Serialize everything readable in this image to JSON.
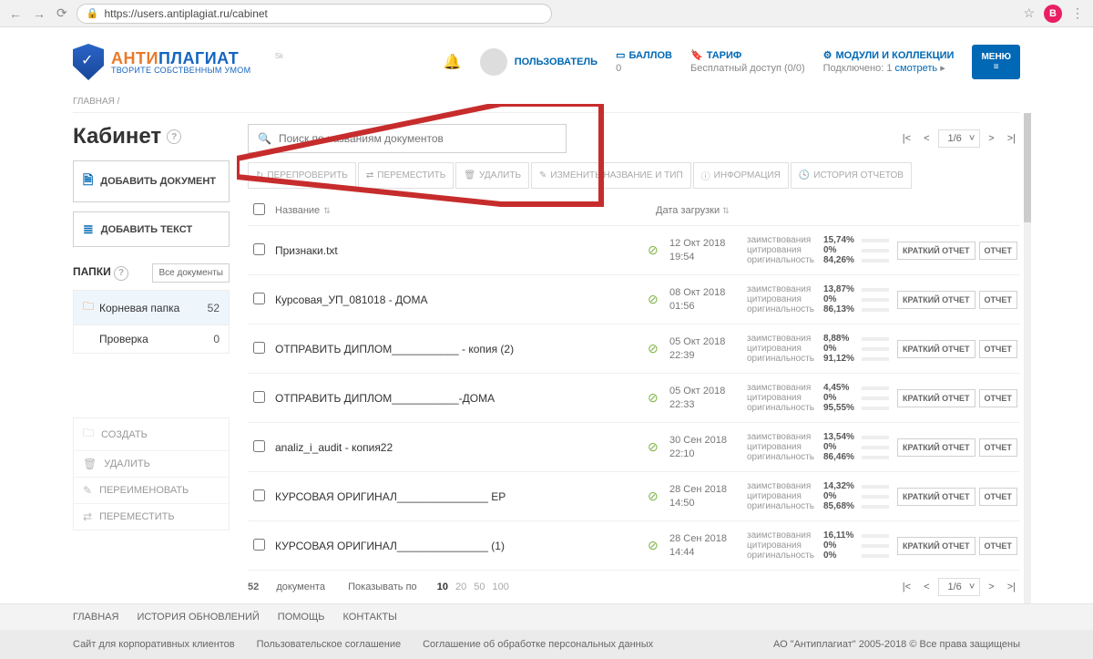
{
  "browser": {
    "url": "https://users.antiplagiat.ru/cabinet",
    "avatar_letter": "B"
  },
  "brand": {
    "part1": "АНТИ",
    "part2": "ПЛАГИАТ",
    "tagline": "ТВОРИТЕ СОБСТВЕННЫМ УМОМ",
    "sk": "Sk"
  },
  "header": {
    "user": "ПОЛЬЗОВАТЕЛЬ",
    "balance_title": "БАЛЛОВ",
    "balance_value": "0",
    "tariff_title": "ТАРИФ",
    "tariff_value": "Бесплатный доступ (0/0)",
    "modules_title": "МОДУЛИ И КОЛЛЕКЦИИ",
    "modules_value_a": "Подключено: 1",
    "modules_value_b": "смотреть",
    "menu": "МЕНЮ"
  },
  "breadcrumb": "ГЛАВНАЯ /",
  "sidebar": {
    "title": "Кабинет",
    "add_doc": "ДОБАВИТЬ ДОКУМЕНТ",
    "add_text": "ДОБАВИТЬ ТЕКСТ",
    "folders_title": "ПАПКИ",
    "all_docs": "Все документы",
    "root_folder": "Корневая папка",
    "root_count": "52",
    "subfolder": "Проверка",
    "sub_count": "0",
    "actions": {
      "create": "СОЗДАТЬ",
      "delete": "УДАЛИТЬ",
      "rename": "ПЕРЕИМЕНОВАТЬ",
      "move": "ПЕРЕМЕСТИТЬ"
    }
  },
  "search": {
    "placeholder": "Поиск по названиям документов"
  },
  "pager": {
    "text": "1/6"
  },
  "toolbar": {
    "recheck": "ПЕРЕПРОВЕРИТЬ",
    "move": "ПЕРЕМЕСТИТЬ",
    "delete": "УДАЛИТЬ",
    "rename": "ИЗМЕНИТЬ НАЗВАНИЕ И ТИП",
    "info": "ИНФОРМАЦИЯ",
    "history": "ИСТОРИЯ ОТЧЕТОВ"
  },
  "table": {
    "col_name": "Название",
    "col_date": "Дата загрузки",
    "total": "52",
    "total_label": "документа",
    "show_label": "Показывать по",
    "page_sizes": [
      "10",
      "20",
      "50",
      "100"
    ],
    "stat_labels": {
      "borrow": "заимствования",
      "cite": "цитирования",
      "orig": "оригинальность"
    },
    "btn_short": "КРАТКИЙ ОТЧЕТ",
    "btn_full": "ОТЧЕТ"
  },
  "docs": [
    {
      "name": "Признаки.txt",
      "date1": "12 Окт 2018",
      "date2": "19:54",
      "borrow": "15,74%",
      "cite": "0%",
      "orig": "84,26%",
      "bp": 16,
      "op": 84
    },
    {
      "name": "Курсовая_УП_081018 - ДОМА",
      "date1": "08 Окт 2018",
      "date2": "01:56",
      "borrow": "13,87%",
      "cite": "0%",
      "orig": "86,13%",
      "bp": 14,
      "op": 86
    },
    {
      "name": "ОТПРАВИТЬ ДИПЛОМ___________ - копия (2)",
      "date1": "05 Окт 2018",
      "date2": "22:39",
      "borrow": "8,88%",
      "cite": "0%",
      "orig": "91,12%",
      "bp": 9,
      "op": 91
    },
    {
      "name": "ОТПРАВИТЬ ДИПЛОМ___________-ДОМА",
      "date1": "05 Окт 2018",
      "date2": "22:33",
      "borrow": "4,45%",
      "cite": "0%",
      "orig": "95,55%",
      "bp": 4,
      "op": 96
    },
    {
      "name": "analiz_i_audit - копия22",
      "date1": "30 Сен 2018",
      "date2": "22:10",
      "borrow": "13,54%",
      "cite": "0%",
      "orig": "86,46%",
      "bp": 14,
      "op": 86
    },
    {
      "name": "КУРСОВАЯ ОРИГИНАЛ_______________ ЕР",
      "date1": "28 Сен 2018",
      "date2": "14:50",
      "borrow": "14,32%",
      "cite": "0%",
      "orig": "85,68%",
      "bp": 14,
      "op": 86
    },
    {
      "name": "КУРСОВАЯ ОРИГИНАЛ_______________ (1)",
      "date1": "28 Сен 2018",
      "date2": "14:44",
      "borrow": "16,11%",
      "cite": "0%",
      "orig": "0%",
      "bp": 16,
      "op": 0
    }
  ],
  "footer": {
    "nav": [
      "ГЛАВНАЯ",
      "ИСТОРИЯ ОБНОВЛЕНИЙ",
      "ПОМОЩЬ",
      "КОНТАКТЫ"
    ],
    "links": [
      "Сайт для корпоративных клиентов",
      "Пользовательское соглашение",
      "Соглашение об обработке персональных данных"
    ],
    "copyright": "АО \"Антиплагиат\" 2005-2018 © Все права защищены"
  }
}
